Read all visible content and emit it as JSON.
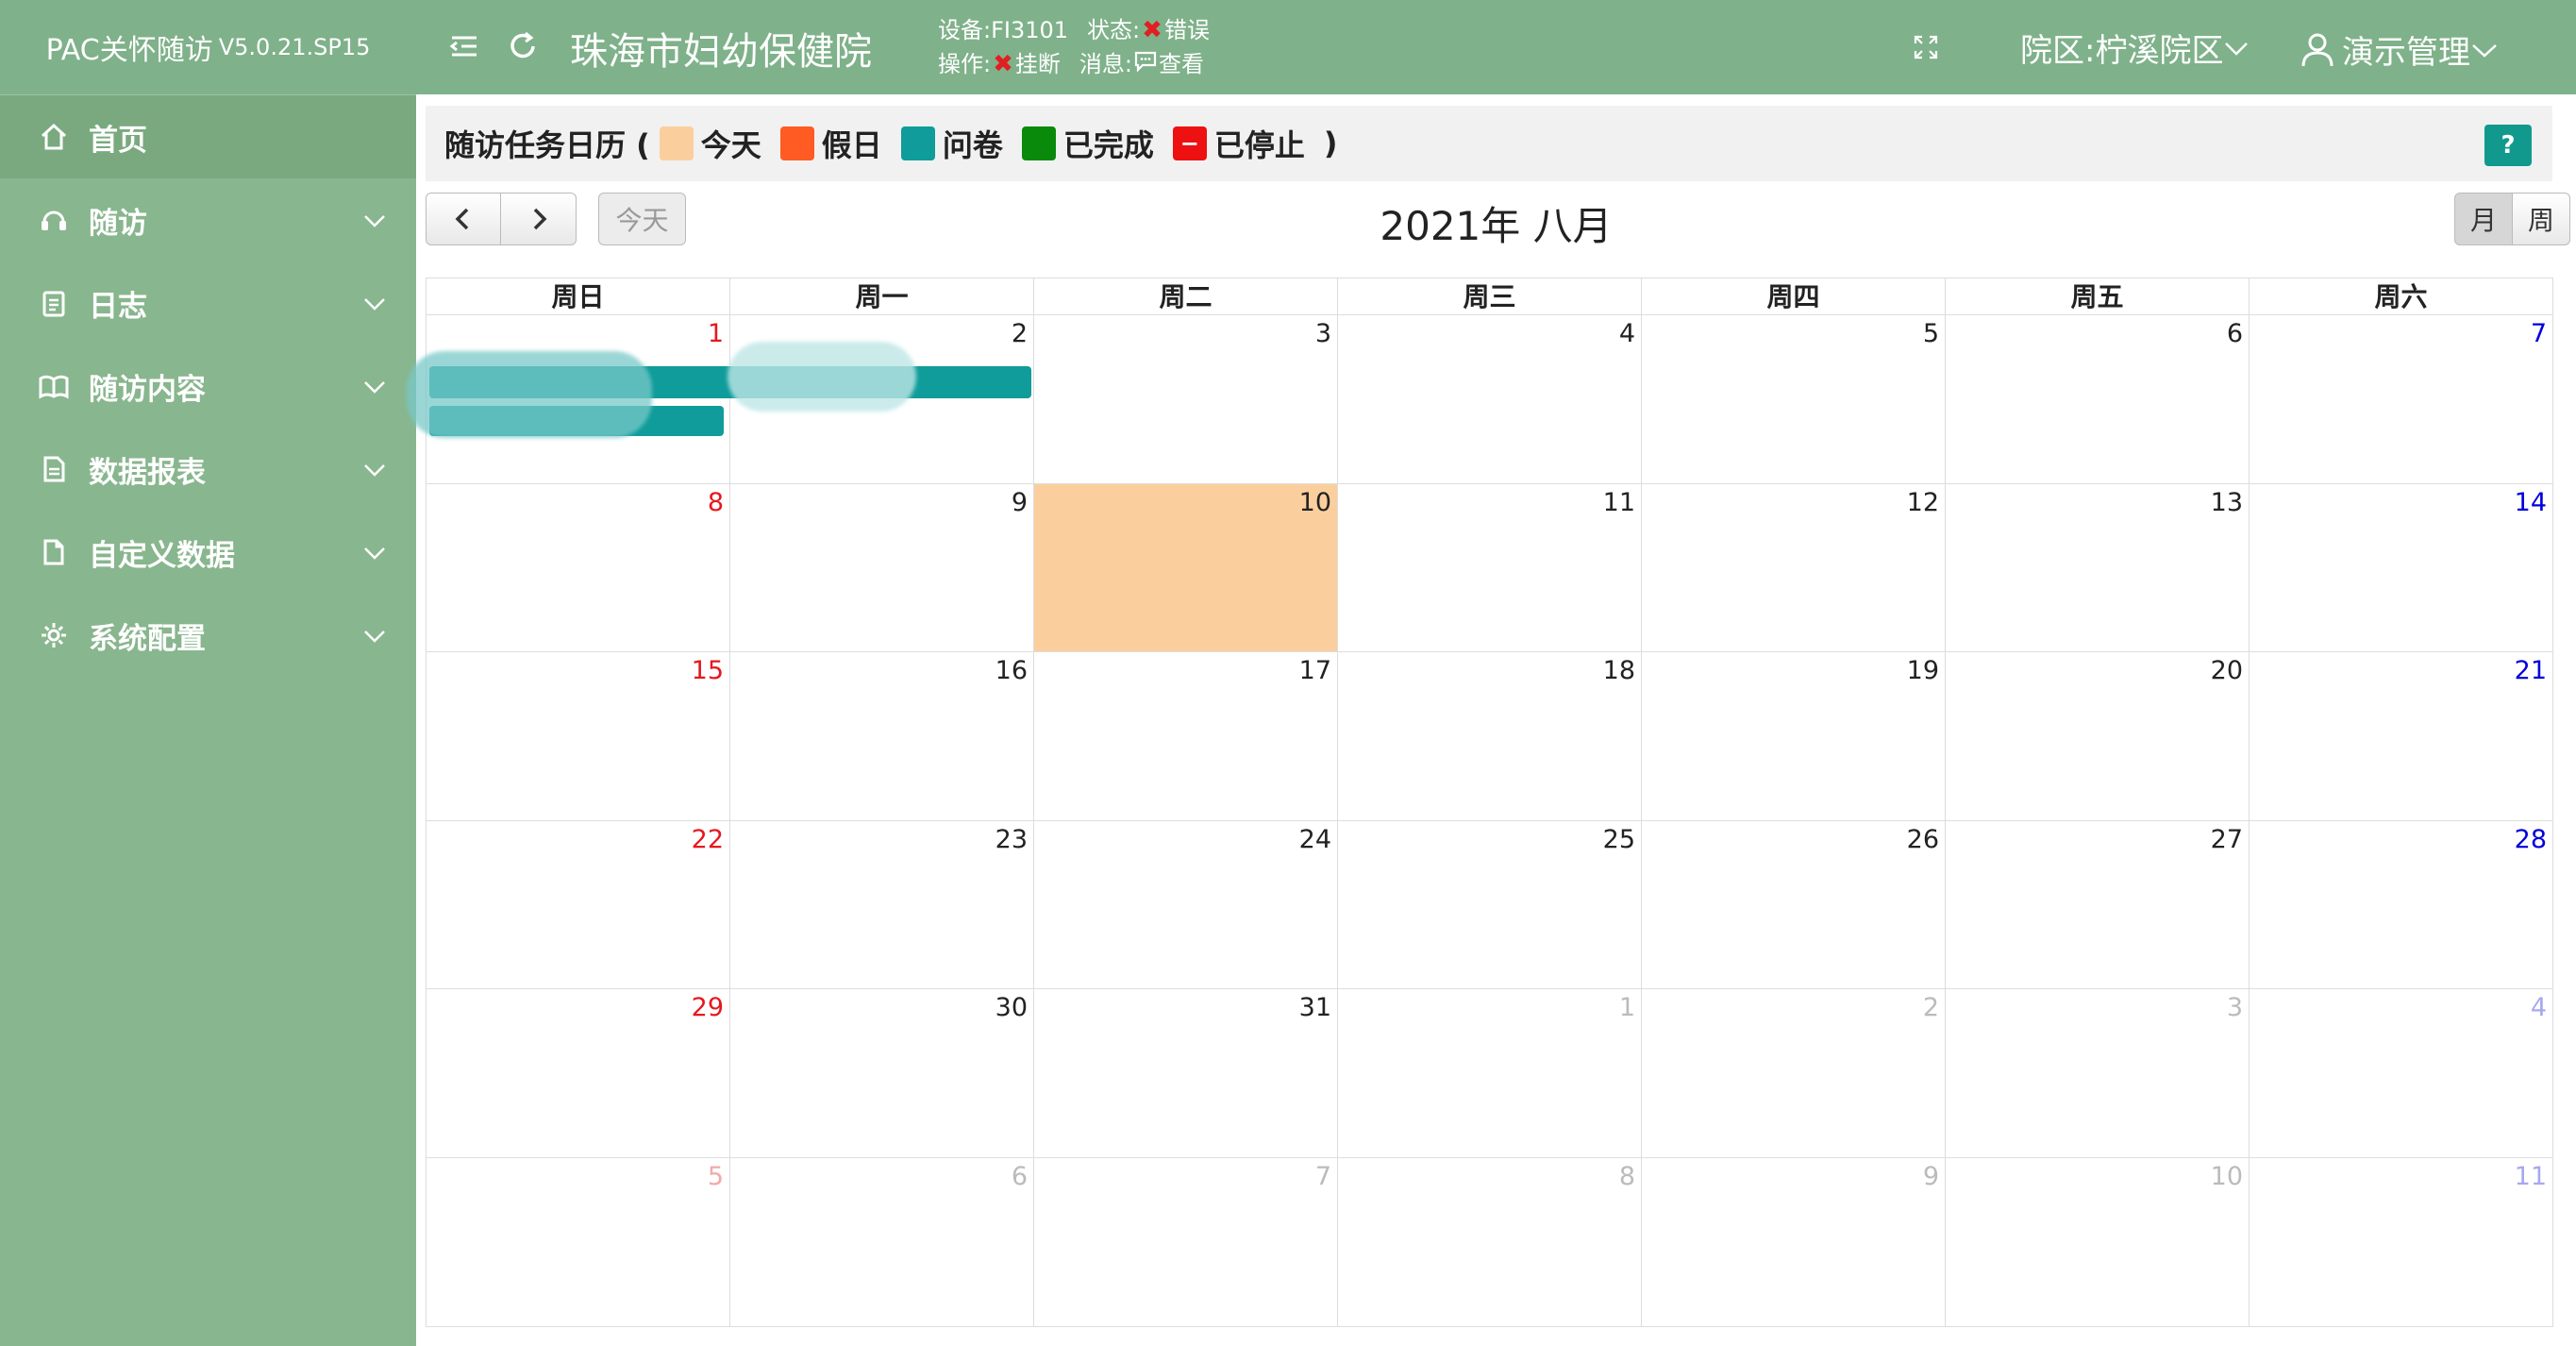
{
  "brand": {
    "name": "PAC关怀随访",
    "version": "V5.0.21.SP15"
  },
  "sidebar": {
    "items": [
      {
        "label": "首页",
        "icon": "home-icon",
        "active": true
      },
      {
        "label": "随访",
        "icon": "headset-icon"
      },
      {
        "label": "日志",
        "icon": "clipboard-icon"
      },
      {
        "label": "随访内容",
        "icon": "book-icon"
      },
      {
        "label": "数据报表",
        "icon": "report-icon"
      },
      {
        "label": "自定义数据",
        "icon": "file-icon"
      },
      {
        "label": "系统配置",
        "icon": "gear-icon"
      }
    ]
  },
  "header": {
    "hospital": "珠海市妇幼保健院",
    "device_label": "设备:",
    "device": "FI3101",
    "status_label": "状态:",
    "status": "错误",
    "operation_label": "操作:",
    "operation": "挂断",
    "message_label": "消息:",
    "message": "查看",
    "campus_label": "院区:",
    "campus": "柠溪院区",
    "user": "演示管理"
  },
  "legend": {
    "title": "随访任务日历 (",
    "close": ")",
    "items": [
      {
        "label": "今天",
        "color": "#fbcf9d"
      },
      {
        "label": "假日",
        "color": "#ff5b22"
      },
      {
        "label": "问卷",
        "color": "#0f9c9a"
      },
      {
        "label": "已完成",
        "color": "#0a8a0a"
      },
      {
        "label": "已停止",
        "color": "#ee1111"
      }
    ],
    "help": "?"
  },
  "toolbar": {
    "today": "今天",
    "month_title": "2021年 八月",
    "view_month": "月",
    "view_week": "周"
  },
  "calendar": {
    "weekdays": [
      "周日",
      "周一",
      "周二",
      "周三",
      "周四",
      "周五",
      "周六"
    ],
    "weeks": [
      [
        "1",
        "2",
        "3",
        "4",
        "5",
        "6",
        "7"
      ],
      [
        "8",
        "9",
        "10",
        "11",
        "12",
        "13",
        "14"
      ],
      [
        "15",
        "16",
        "17",
        "18",
        "19",
        "20",
        "21"
      ],
      [
        "22",
        "23",
        "24",
        "25",
        "26",
        "27",
        "28"
      ],
      [
        "29",
        "30",
        "31",
        "1",
        "2",
        "3",
        "4"
      ],
      [
        "5",
        "6",
        "7",
        "8",
        "9",
        "10",
        "11"
      ]
    ],
    "today": "10"
  }
}
